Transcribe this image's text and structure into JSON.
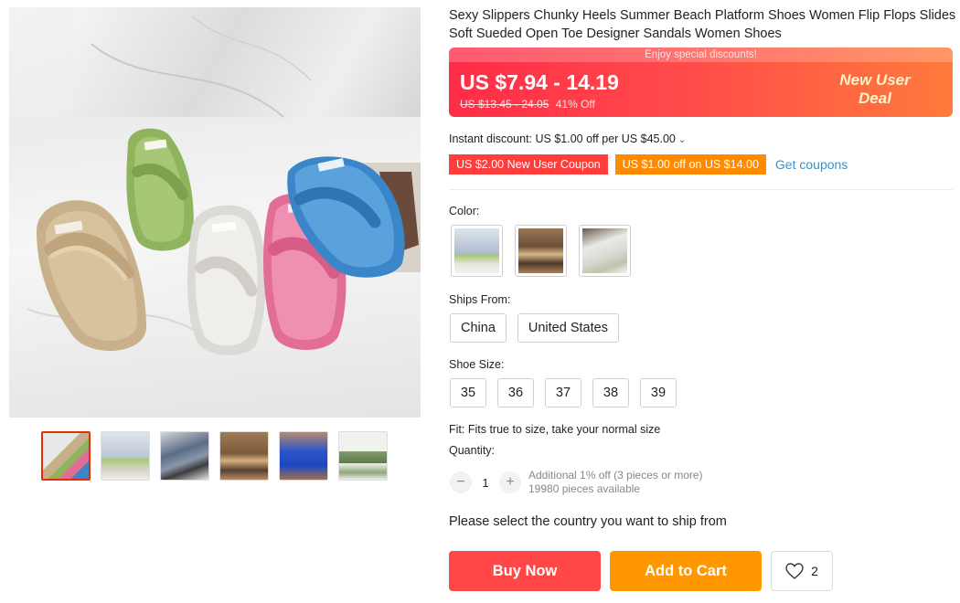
{
  "product": {
    "title": "Sexy Slippers Chunky Heels Summer Beach Platform Shoes Women Flip Flops Slides Soft Sueded Open Toe Designer Sandals Women Shoes"
  },
  "gallery": {
    "thumbnails": [
      "thumbnail-1",
      "thumbnail-2",
      "thumbnail-3",
      "thumbnail-4",
      "thumbnail-5",
      "thumbnail-6"
    ],
    "active_index": 0
  },
  "price": {
    "banner": "Enjoy special discounts!",
    "range": "US $7.94 - 14.19",
    "original": "US $13.45 - 24.05",
    "discount": "41% Off",
    "deal_line1": "New User",
    "deal_line2": "Deal"
  },
  "discounts": {
    "instant": "Instant discount: US $1.00 off per US $45.00",
    "coupon_new_user": "US $2.00 New User Coupon",
    "coupon_off": "US $1.00 off on US $14.00",
    "get_coupons": "Get coupons"
  },
  "color": {
    "label": "Color:"
  },
  "ships_from": {
    "label": "Ships From:",
    "options": [
      "China",
      "United States"
    ]
  },
  "shoe_size": {
    "label": "Shoe Size:",
    "options": [
      "35",
      "36",
      "37",
      "38",
      "39"
    ]
  },
  "fit_note": "Fit: Fits true to size, take your normal size",
  "quantity": {
    "label": "Quantity:",
    "value": "1",
    "note_line1": "Additional 1% off (3 pieces or more)",
    "note_line2": "19980 pieces available",
    "minus": "−",
    "plus": "+"
  },
  "ship_prompt": "Please select the country you want to ship from",
  "actions": {
    "buy_now": "Buy Now",
    "add_to_cart": "Add to Cart",
    "wishlist_count": "2"
  },
  "colors": {
    "accent_red": "#ff4747",
    "accent_orange": "#ff9800",
    "link_blue": "#3f8fbf"
  }
}
